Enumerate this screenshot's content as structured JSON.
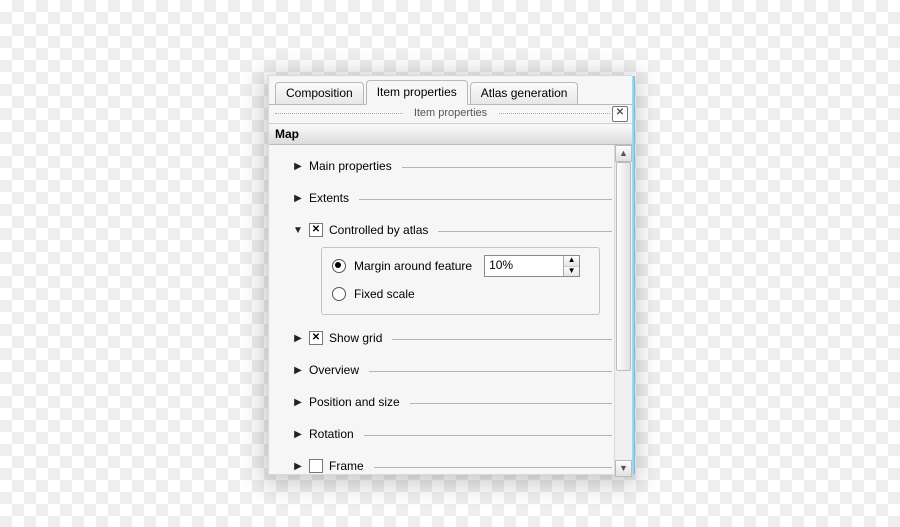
{
  "tabs": {
    "composition": "Composition",
    "item_properties": "Item properties",
    "atlas_generation": "Atlas generation",
    "active": "item_properties"
  },
  "panel_title": "Item properties",
  "group_title": "Map",
  "sections": {
    "main_properties": {
      "label": "Main properties",
      "expanded": false
    },
    "extents": {
      "label": "Extents",
      "expanded": false
    },
    "controlled_by_atlas": {
      "label": "Controlled by atlas",
      "expanded": true,
      "checked": true,
      "options": {
        "margin_around_feature": {
          "label": "Margin around feature",
          "selected": true,
          "value": "10%"
        },
        "fixed_scale": {
          "label": "Fixed scale",
          "selected": false
        }
      }
    },
    "show_grid": {
      "label": "Show grid",
      "expanded": false,
      "checked": true
    },
    "overview": {
      "label": "Overview",
      "expanded": false
    },
    "position_and_size": {
      "label": "Position and size",
      "expanded": false
    },
    "rotation": {
      "label": "Rotation",
      "expanded": false
    },
    "frame": {
      "label": "Frame",
      "expanded": false,
      "checked": false
    }
  }
}
